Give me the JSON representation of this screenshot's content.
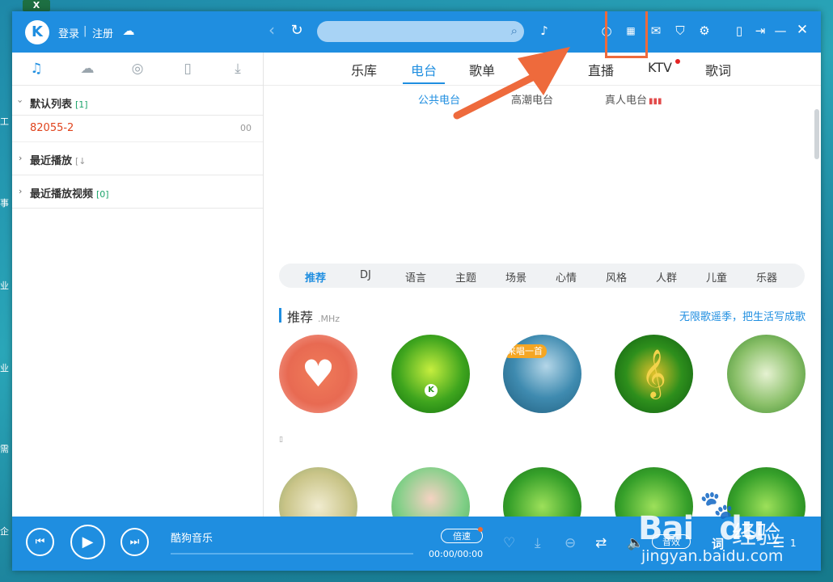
{
  "desktop": {
    "excel_label": "X",
    "left_labels": [
      "工",
      "事",
      "业",
      "业",
      "需",
      "企"
    ]
  },
  "titlebar": {
    "logo": "K",
    "login": "登录",
    "separator": "|",
    "register": "注册",
    "search_placeholder": ""
  },
  "sidebar": {
    "tabs": [
      {
        "icon": "music-note-icon",
        "glyph": "♫"
      },
      {
        "icon": "cloud-icon",
        "glyph": "☁"
      },
      {
        "icon": "radio-icon",
        "glyph": "◎"
      },
      {
        "icon": "device-icon",
        "glyph": "▯"
      },
      {
        "icon": "download-icon",
        "glyph": "⤓"
      }
    ],
    "default_list": {
      "title": "默认列表",
      "count": "[1]"
    },
    "song": {
      "name": "82055-2",
      "duration": "00"
    },
    "recent_play": {
      "title": "最近播放",
      "count": "[↓"
    },
    "recent_video": {
      "title": "最近播放视频",
      "count": "[0]"
    }
  },
  "main": {
    "nav": [
      "乐库",
      "电台",
      "歌单",
      "直播",
      "KTV",
      "歌词"
    ],
    "sub_tabs": [
      "公共电台",
      "高潮电台",
      "真人电台"
    ],
    "categories": [
      "推荐",
      "DJ",
      "语言",
      "主题",
      "场景",
      "心情",
      "风格",
      "人群",
      "儿童",
      "乐器"
    ],
    "section": {
      "title": "推荐",
      "unit": ".MHz",
      "link": "无限歌遥季，把生活写成歌"
    },
    "badge": "来唱一首",
    "placeholder_char": "▯"
  },
  "player": {
    "title": "酷狗音乐",
    "speed": "倍速",
    "time": "00:00/00:00",
    "sfx": "音效",
    "lyric": "词",
    "list_count": "1"
  },
  "watermark": {
    "brand": "Bai",
    "brand2": "du",
    "cn": "经验",
    "url": "jingyan.baidu.com"
  }
}
